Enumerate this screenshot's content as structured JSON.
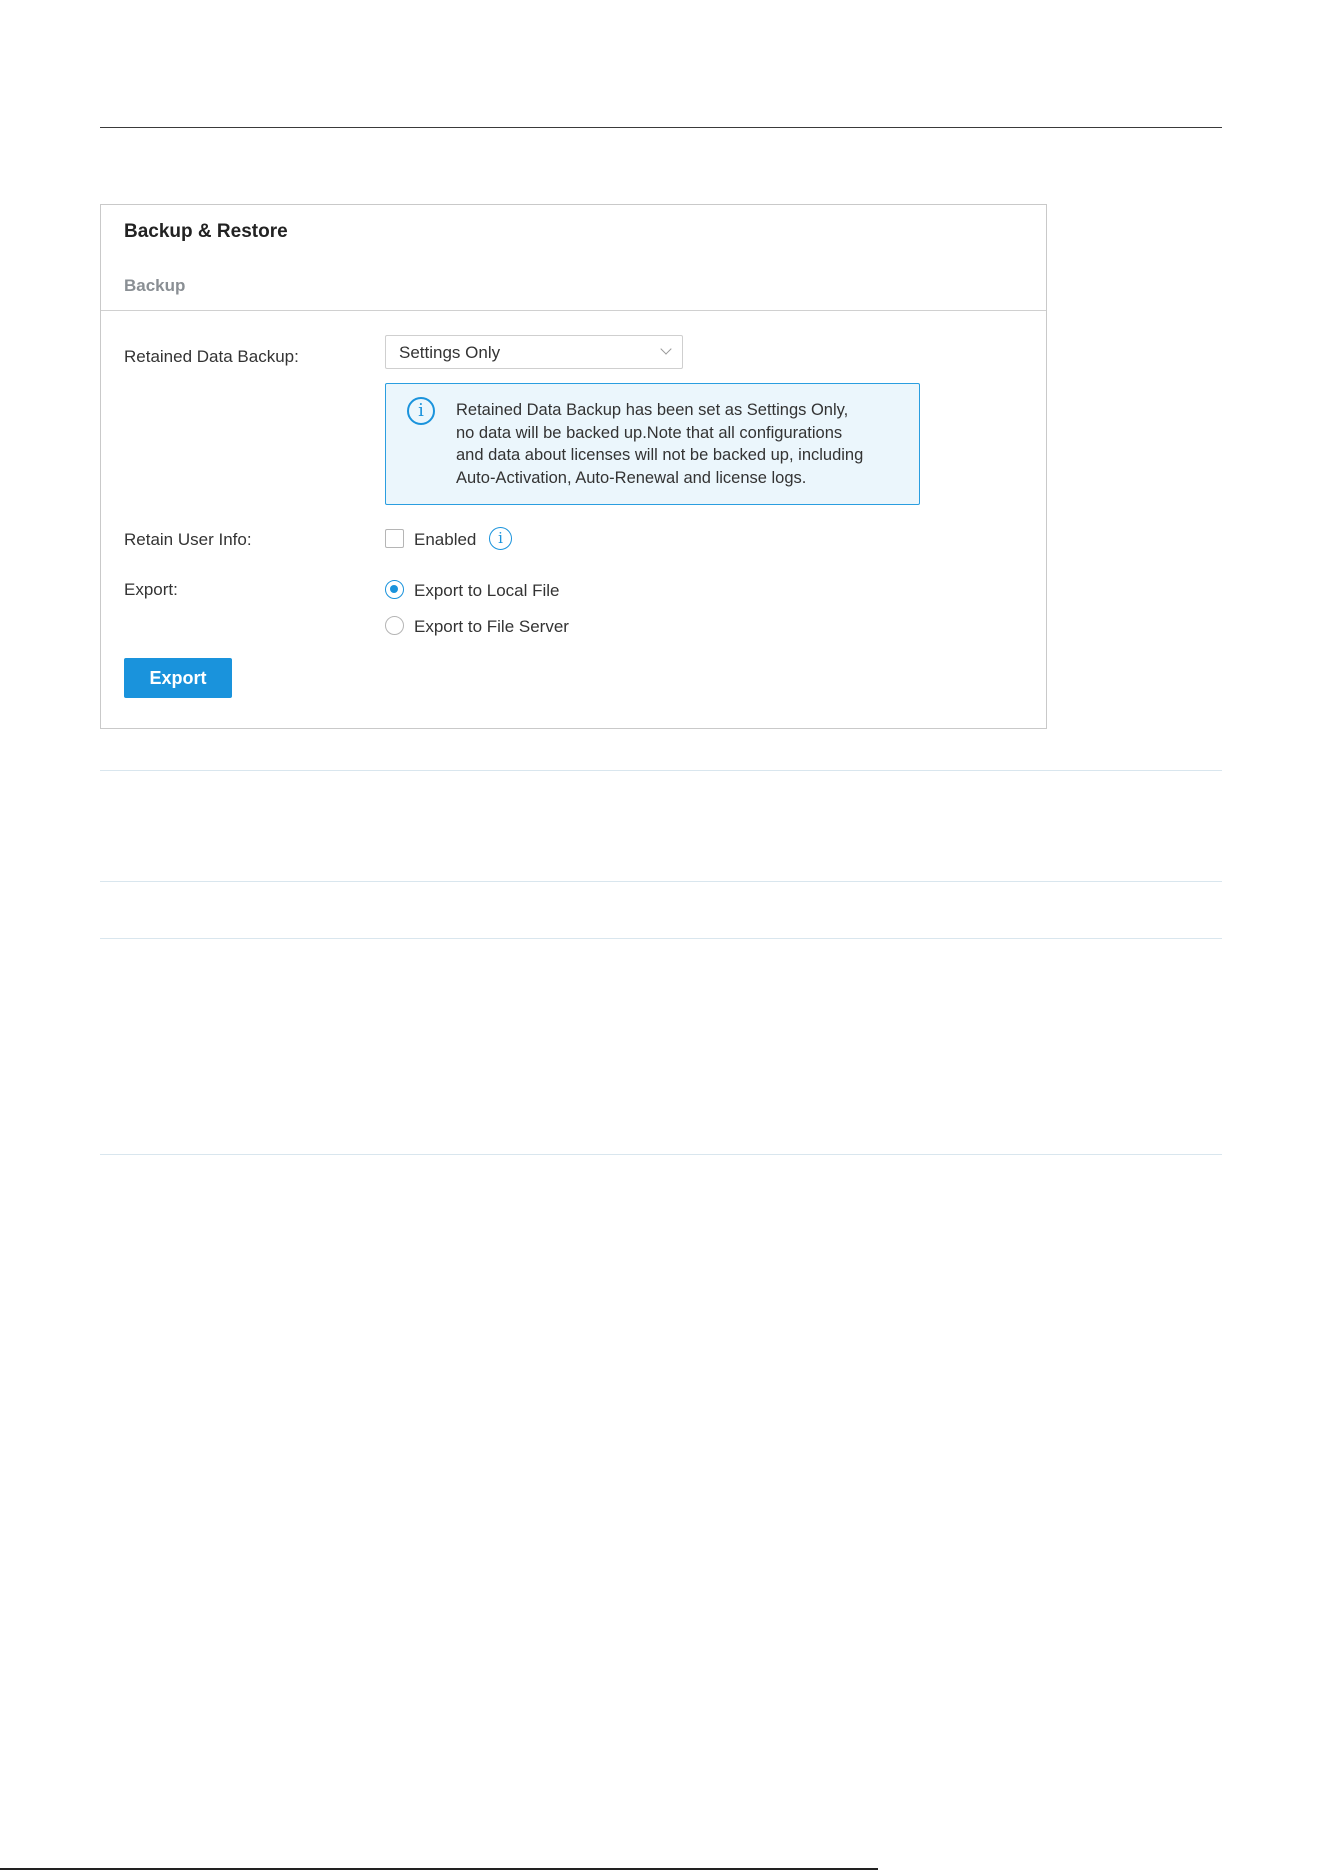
{
  "panel": {
    "title": "Backup & Restore",
    "section_title": "Backup"
  },
  "fields": {
    "retained_data_backup": {
      "label": "Retained Data Backup:",
      "value": "Settings Only"
    },
    "notice": {
      "lines": [
        "Retained Data Backup has been set as Settings Only,",
        "no data will be backed up.Note that all configurations",
        "and data about licenses will not be backed up, including",
        "Auto-Activation, Auto-Renewal and license logs."
      ]
    },
    "retain_user_info": {
      "label": "Retain User Info:",
      "checkbox_label": "Enabled",
      "checked": false
    },
    "export": {
      "label": "Export:",
      "options": [
        "Export to Local File",
        "Export to File Server"
      ],
      "selected": "Export to Local File"
    }
  },
  "actions": {
    "export_label": "Export"
  },
  "colors": {
    "accent": "#1a93dc",
    "notice_bg": "#ebf6fc",
    "section_title": "#8a8f94"
  },
  "icons": {
    "dropdown": "chevron-down-icon",
    "notice": "info-icon",
    "help": "info-icon"
  }
}
